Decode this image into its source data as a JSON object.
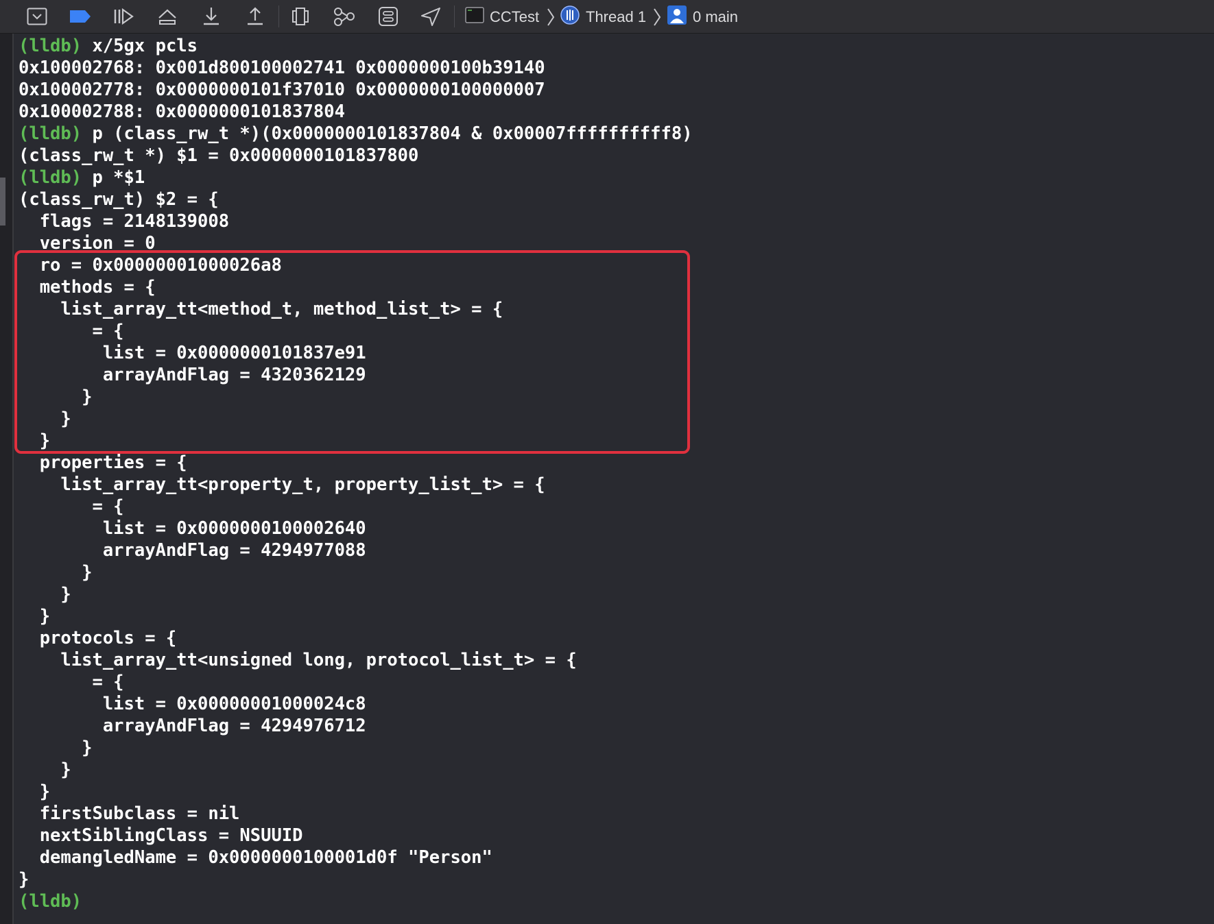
{
  "toolbar": {
    "buttons": [
      {
        "name": "hide-console-icon"
      },
      {
        "name": "breakpoints-toggle-icon"
      },
      {
        "name": "continue-icon"
      },
      {
        "name": "step-over-icon"
      },
      {
        "name": "step-into-icon"
      },
      {
        "name": "step-out-icon"
      },
      {
        "name": "debug-view-hierarchy-icon"
      },
      {
        "name": "debug-memory-graph-icon"
      },
      {
        "name": "environment-overrides-icon"
      },
      {
        "name": "simulate-location-icon"
      }
    ],
    "breadcrumbs": {
      "target": "CCTest",
      "thread": "Thread 1",
      "frame": "0 main"
    },
    "colors": {
      "breakpoint_accent": "#3b82f6"
    }
  },
  "console": {
    "prompt": "(lldb)",
    "lines": [
      {
        "prompt": "(lldb)",
        "text": " x/5gx pcls"
      },
      {
        "text": "0x100002768: 0x001d800100002741 0x0000000100b39140"
      },
      {
        "text": "0x100002778: 0x0000000101f37010 0x0000000100000007"
      },
      {
        "text": "0x100002788: 0x0000000101837804"
      },
      {
        "prompt": "(lldb)",
        "text": " p (class_rw_t *)(0x0000000101837804 & 0x00007ffffffffff8)"
      },
      {
        "text": "(class_rw_t *) $1 = 0x0000000101837800"
      },
      {
        "prompt": "(lldb)",
        "text": " p *$1"
      },
      {
        "text": "(class_rw_t) $2 = {"
      },
      {
        "text": "  flags = 2148139008"
      },
      {
        "text": "  version = 0"
      },
      {
        "text": "  ro = 0x00000001000026a8"
      },
      {
        "text": "  methods = {"
      },
      {
        "text": "    list_array_tt<method_t, method_list_t> = {"
      },
      {
        "text": "       = {"
      },
      {
        "text": "        list = 0x0000000101837e91"
      },
      {
        "text": "        arrayAndFlag = 4320362129"
      },
      {
        "text": "      }"
      },
      {
        "text": "    }"
      },
      {
        "text": "  }"
      },
      {
        "text": "  properties = {"
      },
      {
        "text": "    list_array_tt<property_t, property_list_t> = {"
      },
      {
        "text": "       = {"
      },
      {
        "text": "        list = 0x0000000100002640"
      },
      {
        "text": "        arrayAndFlag = 4294977088"
      },
      {
        "text": "      }"
      },
      {
        "text": "    }"
      },
      {
        "text": "  }"
      },
      {
        "text": "  protocols = {"
      },
      {
        "text": "    list_array_tt<unsigned long, protocol_list_t> = {"
      },
      {
        "text": "       = {"
      },
      {
        "text": "        list = 0x00000001000024c8"
      },
      {
        "text": "        arrayAndFlag = 4294976712"
      },
      {
        "text": "      }"
      },
      {
        "text": "    }"
      },
      {
        "text": "  }"
      },
      {
        "text": "  firstSubclass = nil"
      },
      {
        "text": "  nextSiblingClass = NSUUID"
      },
      {
        "text": "  demangledName = 0x0000000100001d0f \"Person\""
      },
      {
        "text": "}"
      },
      {
        "prompt": "(lldb)",
        "text": ""
      }
    ],
    "colors": {
      "background": "#292a30",
      "text": "#ffffff",
      "prompt": "#5fbc55",
      "highlight_border": "#e0303e"
    }
  }
}
